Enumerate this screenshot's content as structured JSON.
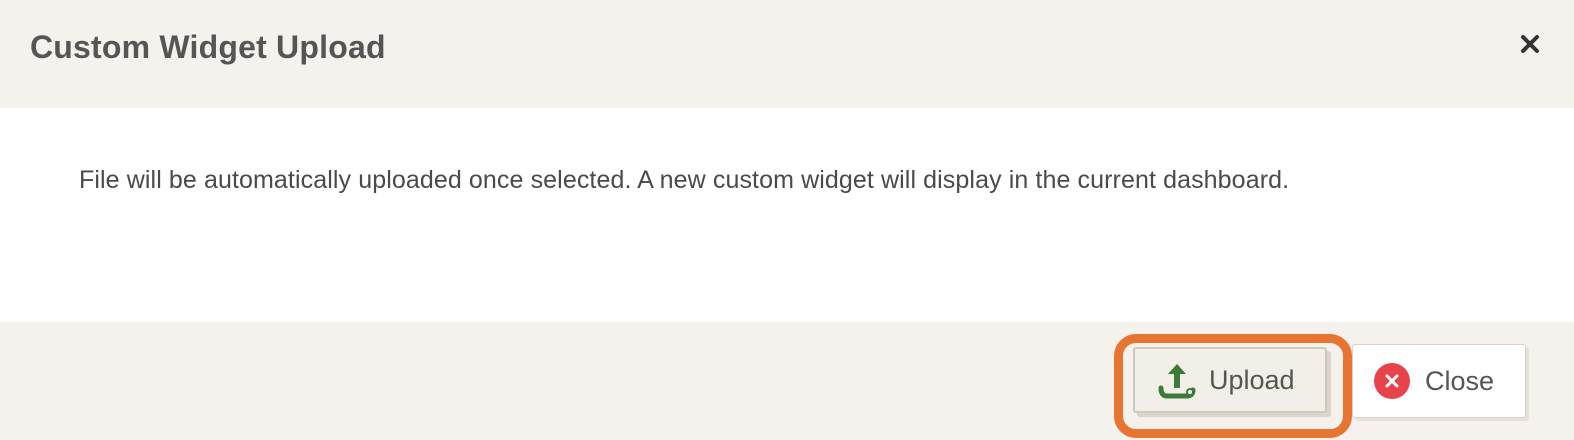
{
  "dialog": {
    "title": "Custom Widget Upload",
    "close_icon": "close-icon",
    "message": "File will be automatically uploaded once selected. A new custom widget will display in the current dashboard.",
    "buttons": {
      "upload": {
        "label": "Upload",
        "icon": "upload-icon"
      },
      "close": {
        "label": "Close",
        "icon": "close-circle-icon"
      }
    }
  },
  "colors": {
    "header_bg": "#f5f1ed",
    "body_bg": "#ffffff",
    "highlight": "#e87432",
    "upload_icon": "#3d7a3a",
    "close_icon_bg": "#e8424a",
    "text": "#555555"
  }
}
